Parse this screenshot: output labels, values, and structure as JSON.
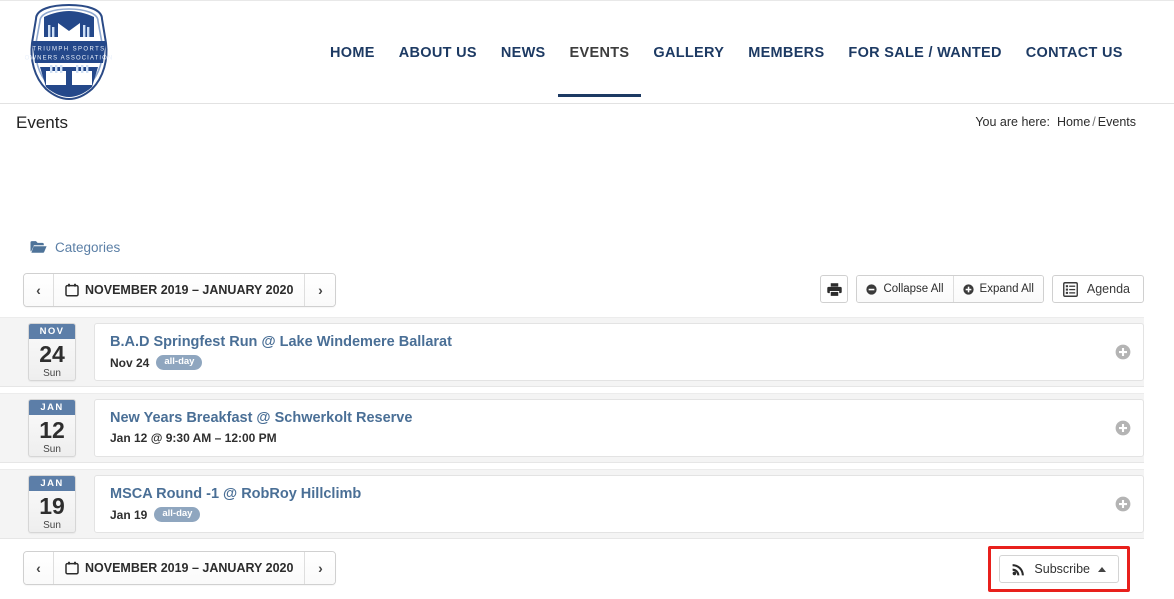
{
  "site": {
    "logo_alt": "Triumph Sports Owners Association",
    "logo_line1": "TRIUMPH  SPORTS",
    "logo_line2": "OWNERS  ASSOCIATION"
  },
  "nav": {
    "items": [
      {
        "label": "HOME",
        "active": false
      },
      {
        "label": "ABOUT US",
        "active": false
      },
      {
        "label": "NEWS",
        "active": false
      },
      {
        "label": "EVENTS",
        "active": true
      },
      {
        "label": "GALLERY",
        "active": false
      },
      {
        "label": "MEMBERS",
        "active": false
      },
      {
        "label": "FOR SALE / WANTED",
        "active": false
      },
      {
        "label": "CONTACT US",
        "active": false
      }
    ]
  },
  "page": {
    "title": "Events",
    "breadcrumb_lead": "You are here:",
    "breadcrumb_home": "Home",
    "breadcrumb_sep": "/",
    "breadcrumb_current": "Events"
  },
  "calendar": {
    "categories_label": "Categories",
    "range_label": "NOVEMBER 2019 – JANUARY 2020",
    "prev_label": "‹",
    "next_label": "›",
    "collapse_all": "Collapse All",
    "expand_all": "Expand All",
    "agenda_label": "Agenda",
    "subscribe_label": "Subscribe",
    "footer_range_label": "NOVEMBER 2019 – JANUARY 2020"
  },
  "events": [
    {
      "month": "NOV",
      "day": "24",
      "dow": "Sun",
      "title": "B.A.D Springfest Run @ Lake Windemere Ballarat",
      "date_text": "Nov 24",
      "time_text": "",
      "all_day": "all-day"
    },
    {
      "month": "JAN",
      "day": "12",
      "dow": "Sun",
      "title": "New Years Breakfast @ Schwerkolt Reserve",
      "date_text": "Jan 12 @ 9:30 AM – 12:00 PM",
      "time_text": "",
      "all_day": ""
    },
    {
      "month": "JAN",
      "day": "19",
      "dow": "Sun",
      "title": "MSCA Round -1 @ RobRoy Hillclimb",
      "date_text": "Jan 19",
      "time_text": "",
      "all_day": "all-day"
    }
  ],
  "colors": {
    "nav_link": "#1d3a63",
    "event_title": "#4a6f96",
    "badge_month": "#5c7ea8",
    "allday_pill": "#8fa6bf",
    "highlight_box": "#e8201c"
  }
}
